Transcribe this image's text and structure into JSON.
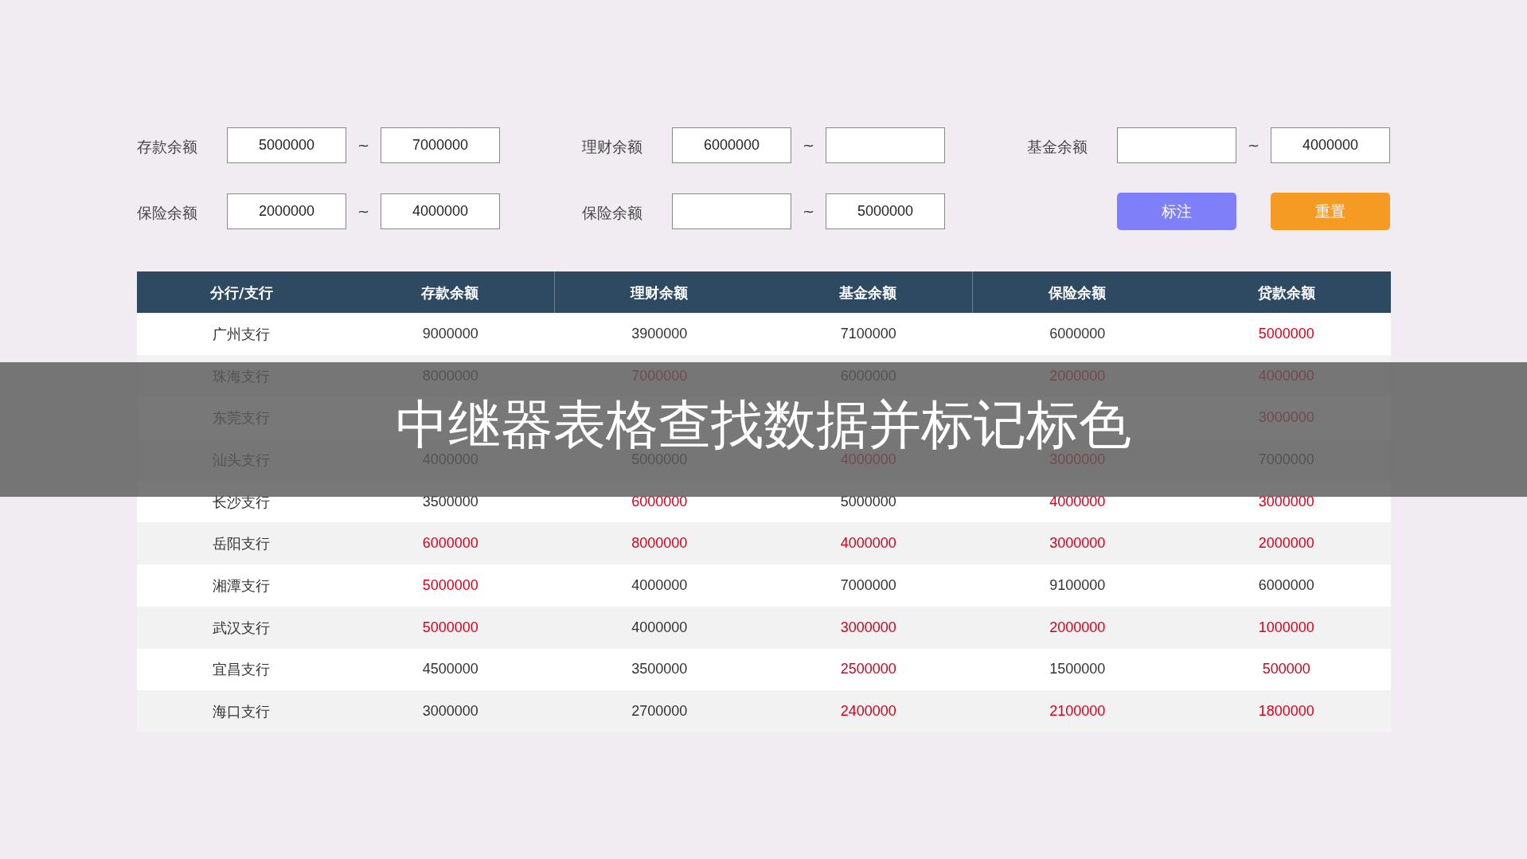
{
  "filters": [
    {
      "label": "存款余额",
      "min": {
        "value": "5000000"
      },
      "separator": "~",
      "max": {
        "value": "7000000"
      }
    },
    {
      "label": "理财余额",
      "min": {
        "value": "6000000"
      },
      "separator": "~"
    },
    {
      "label": "基金余额",
      "separator": "~",
      "max": {
        "value": "4000000"
      }
    },
    {
      "label": "保险余额",
      "min": {
        "value": "2000000"
      },
      "separator": "~",
      "max": {
        "value": "4000000"
      }
    },
    {
      "label": "保险余额",
      "separator": "~",
      "max": {
        "value": "5000000"
      }
    }
  ],
  "buttons": [
    {
      "label": "标注",
      "kind": "mark"
    },
    {
      "label": "重置",
      "kind": "reset"
    }
  ],
  "table": {
    "columns": [
      "分行/支行",
      "存款余额",
      "理财余额",
      "基金余额",
      "保险余额",
      "贷款余额"
    ],
    "rows": [
      [
        {
          "text": "广州支行",
          "marked": false
        },
        {
          "text": "9000000",
          "marked": false
        },
        {
          "text": "3900000",
          "marked": false
        },
        {
          "text": "7100000",
          "marked": false
        },
        {
          "text": "6000000",
          "marked": false
        },
        {
          "text": "5000000",
          "marked": true
        }
      ],
      [
        {
          "text": "珠海支行",
          "marked": false
        },
        {
          "text": "8000000",
          "marked": false
        },
        {
          "text": "7000000",
          "marked": true
        },
        {
          "text": "6000000",
          "marked": false
        },
        {
          "text": "2000000",
          "marked": true
        },
        {
          "text": "4000000",
          "marked": true
        }
      ],
      [
        {
          "text": "东莞支行",
          "marked": false
        },
        "",
        "",
        "",
        "",
        {
          "text": "3000000",
          "marked": true
        }
      ],
      [
        {
          "text": "汕头支行",
          "marked": false
        },
        {
          "text": "4000000",
          "marked": false
        },
        {
          "text": "5000000",
          "marked": false
        },
        {
          "text": "4000000",
          "marked": true
        },
        {
          "text": "3000000",
          "marked": true
        },
        {
          "text": "7000000",
          "marked": false
        }
      ],
      [
        {
          "text": "长沙支行",
          "marked": false
        },
        {
          "text": "3500000",
          "marked": false
        },
        {
          "text": "6000000",
          "marked": true
        },
        {
          "text": "5000000",
          "marked": false
        },
        {
          "text": "4000000",
          "marked": true
        },
        {
          "text": "3000000",
          "marked": true
        }
      ],
      [
        {
          "text": "岳阳支行",
          "marked": false
        },
        {
          "text": "6000000",
          "marked": true
        },
        {
          "text": "8000000",
          "marked": true
        },
        {
          "text": "4000000",
          "marked": true
        },
        {
          "text": "3000000",
          "marked": true
        },
        {
          "text": "2000000",
          "marked": true
        }
      ],
      [
        {
          "text": "湘潭支行",
          "marked": false
        },
        {
          "text": "5000000",
          "marked": true
        },
        {
          "text": "4000000",
          "marked": false
        },
        {
          "text": "7000000",
          "marked": false
        },
        {
          "text": "9100000",
          "marked": false
        },
        {
          "text": "6000000",
          "marked": false
        }
      ],
      [
        {
          "text": "武汉支行",
          "marked": false
        },
        {
          "text": "5000000",
          "marked": true
        },
        {
          "text": "4000000",
          "marked": false
        },
        {
          "text": "3000000",
          "marked": true
        },
        {
          "text": "2000000",
          "marked": true
        },
        {
          "text": "1000000",
          "marked": true
        }
      ],
      [
        {
          "text": "宜昌支行",
          "marked": false
        },
        {
          "text": "4500000",
          "marked": false
        },
        {
          "text": "3500000",
          "marked": false
        },
        {
          "text": "2500000",
          "marked": true
        },
        {
          "text": "1500000",
          "marked": false
        },
        {
          "text": "500000",
          "marked": true
        }
      ],
      [
        {
          "text": "海口支行",
          "marked": false
        },
        {
          "text": "3000000",
          "marked": false
        },
        {
          "text": "2700000",
          "marked": false
        },
        {
          "text": "2400000",
          "marked": true
        },
        {
          "text": "2100000",
          "marked": true
        },
        {
          "text": "1800000",
          "marked": true
        }
      ]
    ]
  },
  "banner": {
    "title": "中继器表格查找数据并标记标色"
  }
}
